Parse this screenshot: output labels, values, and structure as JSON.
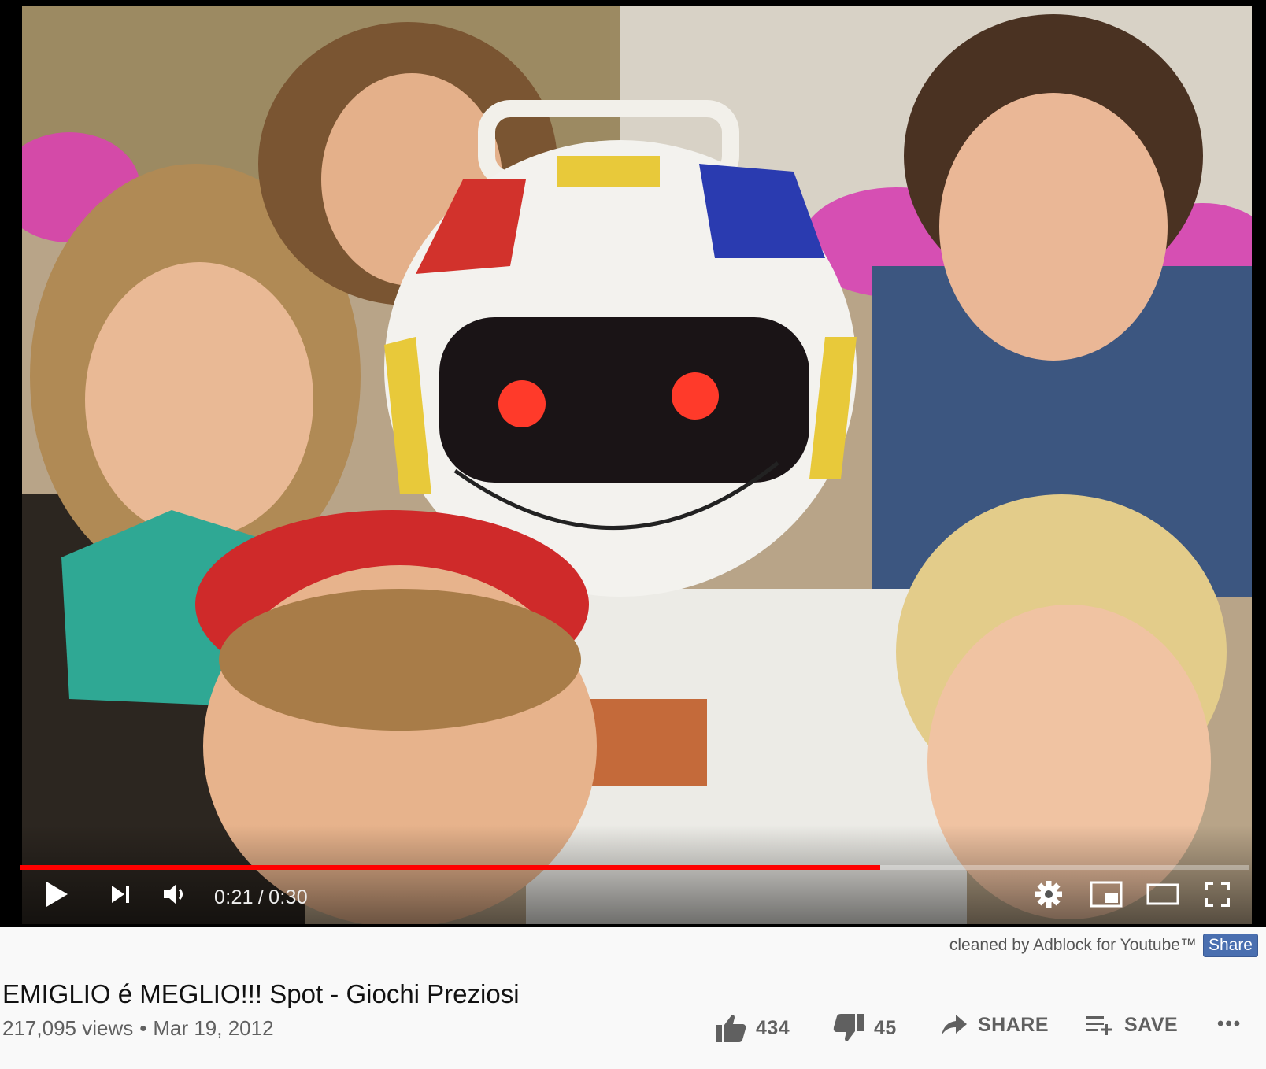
{
  "player": {
    "time_current": "0:21",
    "time_separator": "/",
    "time_total": "0:30",
    "progress_fraction": 0.7,
    "colors": {
      "played": "#ff0000",
      "track": "rgba(255,255,255,0.35)"
    },
    "icons": [
      "play-icon",
      "next-icon",
      "volume-icon",
      "settings-gear-icon",
      "miniplayer-icon",
      "theater-mode-icon",
      "fullscreen-icon"
    ]
  },
  "adblock": {
    "text": "cleaned by Adblock for Youtube™",
    "share_label": "Share"
  },
  "video": {
    "title": "EMIGLIO é MEGLIO!!! Spot - Giochi Preziosi",
    "views": "217,095 views",
    "bullet": "•",
    "date": "Mar 19, 2012"
  },
  "actions": {
    "likes": "434",
    "dislikes": "45",
    "share_label": "SHARE",
    "save_label": "SAVE",
    "more_label": "•••"
  }
}
